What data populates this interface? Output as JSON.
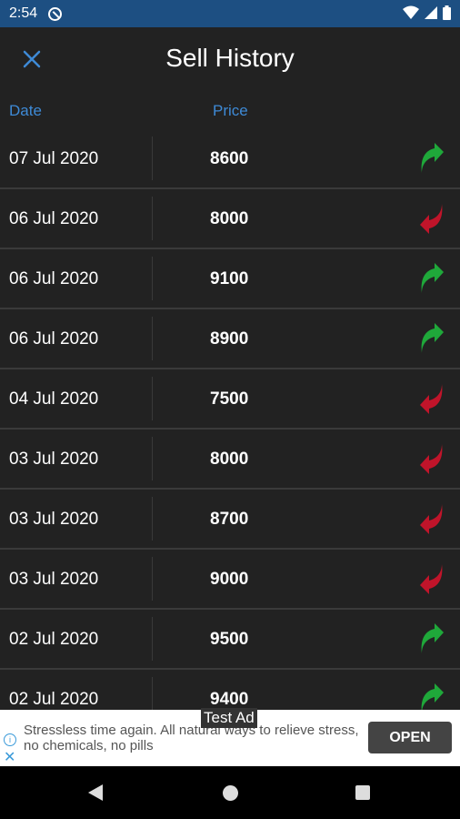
{
  "status_bar": {
    "time": "2:54"
  },
  "header": {
    "title": "Sell History"
  },
  "columns": {
    "date": "Date",
    "price": "Price"
  },
  "colors": {
    "up": "#1fa83a",
    "down": "#c0142a",
    "accent": "#3e8ad6"
  },
  "rows": [
    {
      "date": "07 Jul 2020",
      "price": "8600",
      "trend": "up"
    },
    {
      "date": "06 Jul 2020",
      "price": "8000",
      "trend": "down"
    },
    {
      "date": "06 Jul 2020",
      "price": "9100",
      "trend": "up"
    },
    {
      "date": "06 Jul 2020",
      "price": "8900",
      "trend": "up"
    },
    {
      "date": "04 Jul 2020",
      "price": "7500",
      "trend": "down"
    },
    {
      "date": "03 Jul 2020",
      "price": "8000",
      "trend": "down"
    },
    {
      "date": "03 Jul 2020",
      "price": "8700",
      "trend": "down"
    },
    {
      "date": "03 Jul 2020",
      "price": "9000",
      "trend": "down"
    },
    {
      "date": "02 Jul 2020",
      "price": "9500",
      "trend": "up"
    },
    {
      "date": "02 Jul 2020",
      "price": "9400",
      "trend": "up"
    }
  ],
  "ad": {
    "label": "Test Ad",
    "text": "Stressless time again. All natural ways to relieve stress, no chemicals, no pills",
    "open_label": "OPEN"
  }
}
